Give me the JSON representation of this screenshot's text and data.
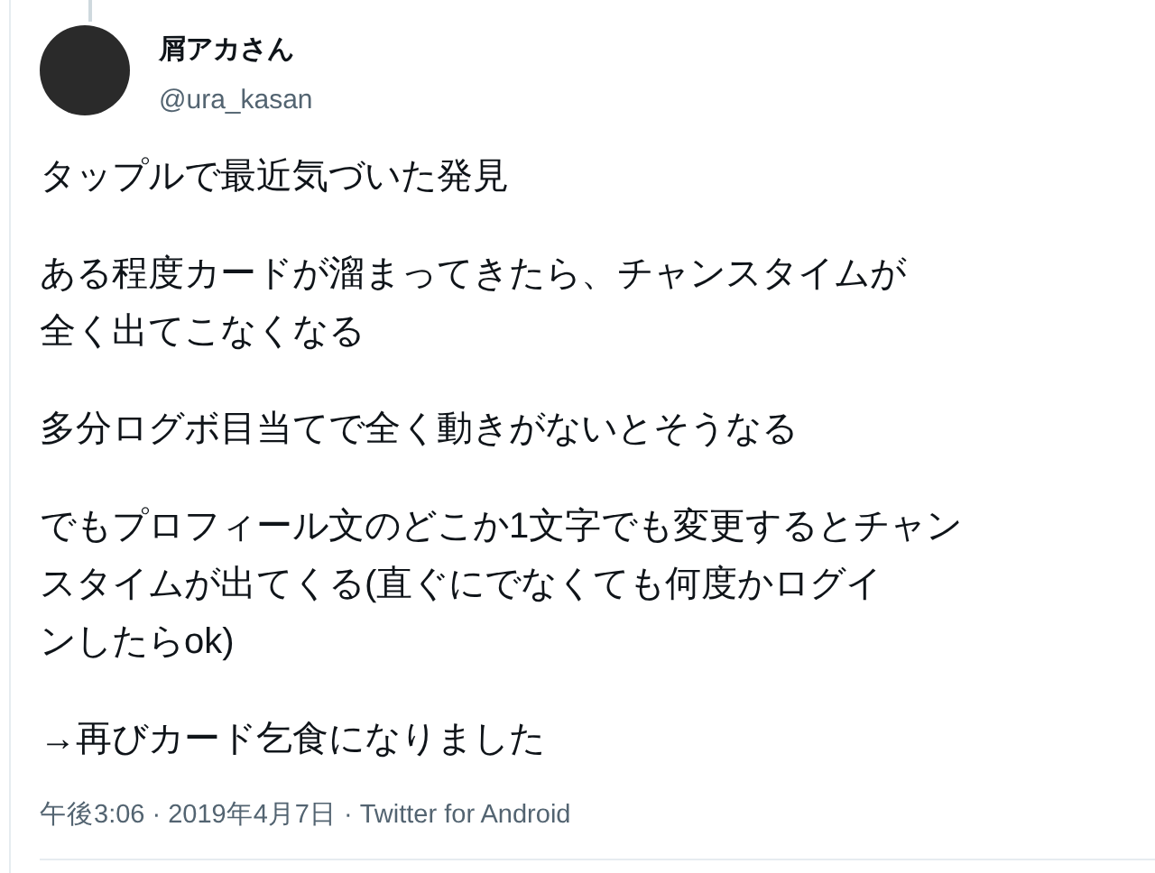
{
  "author": {
    "name": "屑アカさん",
    "handle": "@ura_kasan"
  },
  "paragraphs": [
    {
      "lines": [
        "タップルで最近気づいた発見"
      ]
    },
    {
      "lines": [
        "ある程度カードが溜まってきたら、チャンスタイムが",
        "全く出てこなくなる"
      ]
    },
    {
      "lines": [
        "多分ログボ目当てで全く動きがないとそうなる"
      ]
    },
    {
      "lines": [
        "でもプロフィール文のどこか1文字でも変更するとチャン",
        "スタイムが出てくる(直ぐにでなくても何度かログイ",
        "ンしたらok)"
      ]
    },
    {
      "lines": [
        "→再びカード乞食になりました"
      ]
    }
  ],
  "meta": "午後3:06 · 2019年4月7日 · Twitter for Android"
}
